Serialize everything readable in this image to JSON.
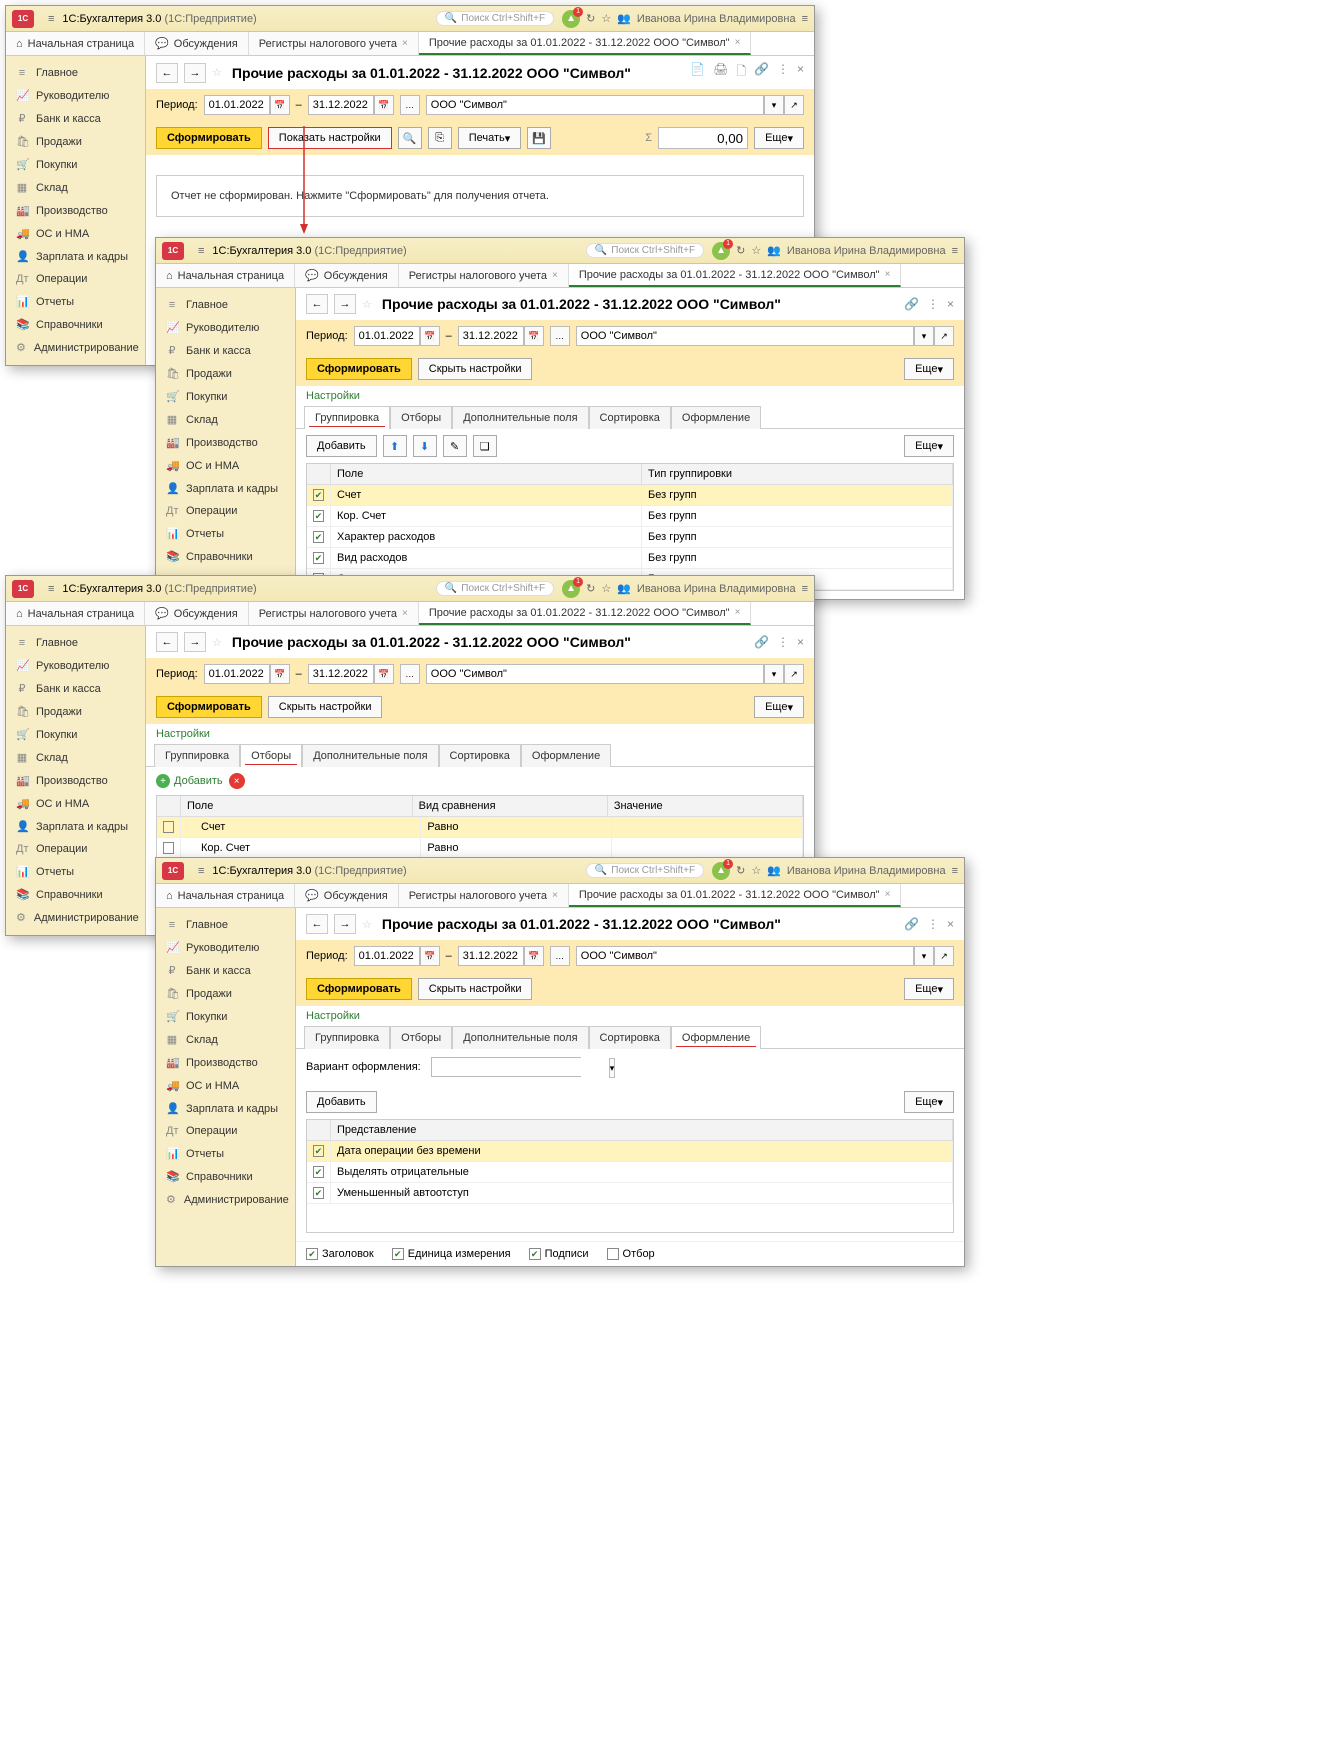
{
  "app": {
    "title": "1С:Бухгалтерия 3.0",
    "subtitle": "(1С:Предприятие)",
    "search_ph": "Поиск Ctrl+Shift+F",
    "user": "Иванова Ирина Владимировна",
    "bell_badge": "1"
  },
  "tabs": {
    "home": "Начальная страница",
    "discuss": "Обсуждения",
    "reg": "Регистры налогового учета",
    "report": "Прочие расходы за 01.01.2022 - 31.12.2022 ООО \"Символ\""
  },
  "sidebar": [
    "Главное",
    "Руководителю",
    "Банк и касса",
    "Продажи",
    "Покупки",
    "Склад",
    "Производство",
    "ОС и НМА",
    "Зарплата и кадры",
    "Операции",
    "Отчеты",
    "Справочники",
    "Администрирование"
  ],
  "page_title": "Прочие расходы за 01.01.2022 - 31.12.2022 ООО \"Символ\"",
  "period": {
    "label": "Период:",
    "from": "01.01.2022",
    "to": "31.12.2022",
    "dash": "–",
    "org": "ООО \"Символ\""
  },
  "buttons": {
    "form": "Сформировать",
    "show_settings": "Показать настройки",
    "hide_settings": "Скрыть настройки",
    "print": "Печать",
    "more": "Еще",
    "add": "Добавить",
    "sum_zero": "0,00"
  },
  "info": "Отчет не сформирован. Нажмите \"Сформировать\" для получения отчета.",
  "settings_label": "Настройки",
  "subtabs": {
    "group": "Группировка",
    "filters": "Отборы",
    "extra": "Дополнительные поля",
    "sort": "Сортировка",
    "design": "Оформление"
  },
  "grid1": {
    "h1": "Поле",
    "h2": "Тип группировки",
    "rows": [
      {
        "f": "Счет",
        "t": "Без групп"
      },
      {
        "f": "Кор. Счет",
        "t": "Без групп"
      },
      {
        "f": "Характер расходов",
        "t": "Без групп"
      },
      {
        "f": "Вид расходов",
        "t": "Без групп"
      },
      {
        "f": "Статья затрат",
        "t": "Без групп"
      }
    ]
  },
  "grid2": {
    "h1": "Поле",
    "h2": "Вид сравнения",
    "h3": "Значение",
    "rows": [
      {
        "f": "Счет",
        "c": "Равно"
      },
      {
        "f": "Кор. Счет",
        "c": "Равно"
      }
    ]
  },
  "design": {
    "variant_label": "Вариант оформления:",
    "grid_h": "Представление",
    "rows": [
      "Дата операции без времени",
      "Выделять отрицательные",
      "Уменьшенный автоотступ"
    ],
    "footer": {
      "title": "Заголовок",
      "unit": "Единица измерения",
      "sign": "Подписи",
      "filter": "Отбор"
    }
  }
}
